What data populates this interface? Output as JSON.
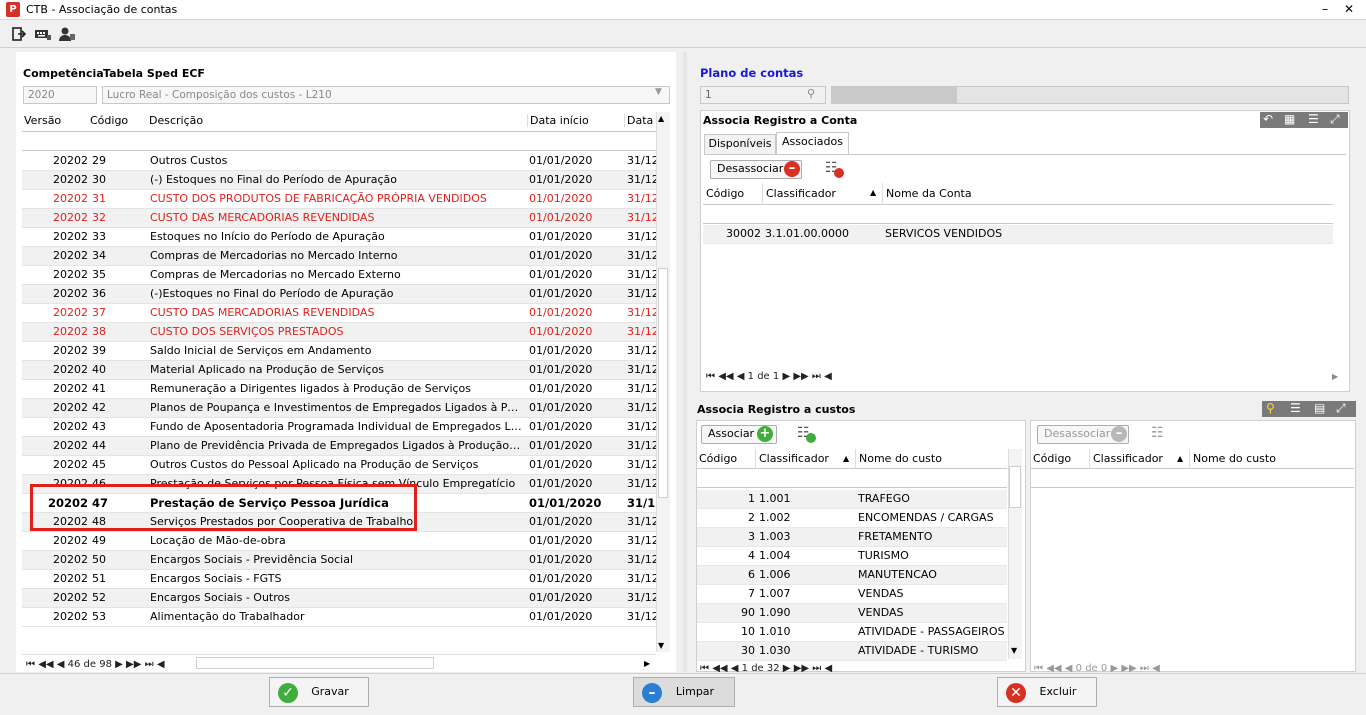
{
  "window": {
    "title": "CTB - Associação de contas",
    "minimize": "–",
    "close": "✕"
  },
  "toolbar": {
    "icons": [
      "exit-icon",
      "keyboard-icon",
      "user-icon"
    ]
  },
  "left": {
    "competencia_label": "Competência",
    "tabela_label": "Tabela Sped ECF",
    "competencia_value": "2020",
    "tabela_value": "Lucro Real - Composição dos custos - L210",
    "columns": [
      "Versão",
      "Código",
      "Descrição",
      "Data início",
      "Data"
    ],
    "rows": [
      {
        "ver": "20202",
        "cod": "29",
        "desc": "Outros Custos",
        "dt": "01/01/2020",
        "dt2": "31/12",
        "style": ""
      },
      {
        "ver": "20202",
        "cod": "30",
        "desc": "(-) Estoques no Final do Período de Apuração",
        "dt": "01/01/2020",
        "dt2": "31/12",
        "style": ""
      },
      {
        "ver": "20202",
        "cod": "31",
        "desc": "CUSTO DOS PRODUTOS DE FABRICAÇÃO PRÓPRIA VENDIDOS",
        "dt": "01/01/2020",
        "dt2": "31/12",
        "style": "red"
      },
      {
        "ver": "20202",
        "cod": "32",
        "desc": "CUSTO DAS MERCADORIAS REVENDIDAS",
        "dt": "01/01/2020",
        "dt2": "31/12",
        "style": "red"
      },
      {
        "ver": "20202",
        "cod": "33",
        "desc": "Estoques no Início do Período de Apuração",
        "dt": "01/01/2020",
        "dt2": "31/12",
        "style": ""
      },
      {
        "ver": "20202",
        "cod": "34",
        "desc": "Compras de Mercadorias no Mercado Interno",
        "dt": "01/01/2020",
        "dt2": "31/12",
        "style": ""
      },
      {
        "ver": "20202",
        "cod": "35",
        "desc": "Compras de Mercadorias no Mercado Externo",
        "dt": "01/01/2020",
        "dt2": "31/12",
        "style": ""
      },
      {
        "ver": "20202",
        "cod": "36",
        "desc": "(-)Estoques no Final do Período de Apuração",
        "dt": "01/01/2020",
        "dt2": "31/12",
        "style": ""
      },
      {
        "ver": "20202",
        "cod": "37",
        "desc": "CUSTO DAS MERCADORIAS REVENDIDAS",
        "dt": "01/01/2020",
        "dt2": "31/12",
        "style": "red"
      },
      {
        "ver": "20202",
        "cod": "38",
        "desc": "CUSTO DOS SERVIÇOS PRESTADOS",
        "dt": "01/01/2020",
        "dt2": "31/12",
        "style": "red"
      },
      {
        "ver": "20202",
        "cod": "39",
        "desc": "Saldo Inicial de Serviços em Andamento",
        "dt": "01/01/2020",
        "dt2": "31/12",
        "style": ""
      },
      {
        "ver": "20202",
        "cod": "40",
        "desc": "Material Aplicado na Produção de Serviços",
        "dt": "01/01/2020",
        "dt2": "31/12",
        "style": ""
      },
      {
        "ver": "20202",
        "cod": "41",
        "desc": "Remuneração a Dirigentes ligados à Produção de Serviços",
        "dt": "01/01/2020",
        "dt2": "31/12",
        "style": ""
      },
      {
        "ver": "20202",
        "cod": "42",
        "desc": "Planos de Poupança e Investimentos de Empregados Ligados à Produção d...",
        "dt": "01/01/2020",
        "dt2": "31/12",
        "style": ""
      },
      {
        "ver": "20202",
        "cod": "43",
        "desc": "Fundo de Aposentadoria Programada Individual de Empregados Ligados à P...",
        "dt": "01/01/2020",
        "dt2": "31/12",
        "style": ""
      },
      {
        "ver": "20202",
        "cod": "44",
        "desc": "Plano de Previdência Privada de Empregados Ligados à Produção de Serviços",
        "dt": "01/01/2020",
        "dt2": "31/12",
        "style": ""
      },
      {
        "ver": "20202",
        "cod": "45",
        "desc": "Outros Custos do Pessoal Aplicado na Produção de Serviços",
        "dt": "01/01/2020",
        "dt2": "31/12",
        "style": ""
      },
      {
        "ver": "20202",
        "cod": "46",
        "desc": "Prestação de Serviços por Pessoa Física sem Vínculo Empregatício",
        "dt": "01/01/2020",
        "dt2": "31/12",
        "style": ""
      },
      {
        "ver": "20202",
        "cod": "47",
        "desc": "Prestação de Serviço Pessoa Jurídica",
        "dt": "01/01/2020",
        "dt2": "31/1",
        "style": "bold"
      },
      {
        "ver": "20202",
        "cod": "48",
        "desc": "Serviços Prestados por Cooperativa de Trabalho",
        "dt": "01/01/2020",
        "dt2": "31/12",
        "style": ""
      },
      {
        "ver": "20202",
        "cod": "49",
        "desc": "Locação de Mão-de-obra",
        "dt": "01/01/2020",
        "dt2": "31/12",
        "style": ""
      },
      {
        "ver": "20202",
        "cod": "50",
        "desc": "Encargos Sociais - Previdência Social",
        "dt": "01/01/2020",
        "dt2": "31/12",
        "style": ""
      },
      {
        "ver": "20202",
        "cod": "51",
        "desc": "Encargos Sociais - FGTS",
        "dt": "01/01/2020",
        "dt2": "31/12",
        "style": ""
      },
      {
        "ver": "20202",
        "cod": "52",
        "desc": "Encargos Sociais - Outros",
        "dt": "01/01/2020",
        "dt2": "31/12",
        "style": ""
      },
      {
        "ver": "20202",
        "cod": "53",
        "desc": "Alimentação do Trabalhador",
        "dt": "01/01/2020",
        "dt2": "31/12",
        "style": ""
      }
    ],
    "pager": "46 de 98"
  },
  "plano": {
    "title": "Plano de contas",
    "value": "1",
    "accent": "#1a1ad6"
  },
  "associa_conta": {
    "title": "Associa Registro a Conta",
    "tabs": [
      "Disponíveis",
      "Associados"
    ],
    "active_tab": "Associados",
    "button": "Desassociar",
    "columns": [
      "Código",
      "Classificador",
      "Nome da Conta"
    ],
    "rows": [
      {
        "cod": "30002",
        "clas": "3.1.01.00.0000",
        "nome": "SERVICOS VENDIDOS"
      }
    ],
    "pager": "1 de 1"
  },
  "associa_custos": {
    "title": "Associa Registro a custos",
    "assoc_button": "Associar",
    "desassoc_button": "Desassociar",
    "columns": [
      "Código",
      "Classificador",
      "Nome do custo"
    ],
    "rows": [
      {
        "cod": "1",
        "clas": "1.001",
        "nome": "TRAFEGO"
      },
      {
        "cod": "2",
        "clas": "1.002",
        "nome": "ENCOMENDAS / CARGAS"
      },
      {
        "cod": "3",
        "clas": "1.003",
        "nome": "FRETAMENTO"
      },
      {
        "cod": "4",
        "clas": "1.004",
        "nome": "TURISMO"
      },
      {
        "cod": "6",
        "clas": "1.006",
        "nome": "MANUTENCAO"
      },
      {
        "cod": "7",
        "clas": "1.007",
        "nome": "VENDAS"
      },
      {
        "cod": "90",
        "clas": "1.090",
        "nome": "VENDAS"
      },
      {
        "cod": "10",
        "clas": "1.010",
        "nome": "ATIVIDADE - PASSAGEIROS"
      },
      {
        "cod": "30",
        "clas": "1.030",
        "nome": "ATIVIDADE - TURISMO"
      }
    ],
    "pager_left": "1 de 32",
    "pager_right": "0 de 0"
  },
  "footer": {
    "gravar": "Gravar",
    "limpar": "Limpar",
    "excluir": "Excluir"
  }
}
